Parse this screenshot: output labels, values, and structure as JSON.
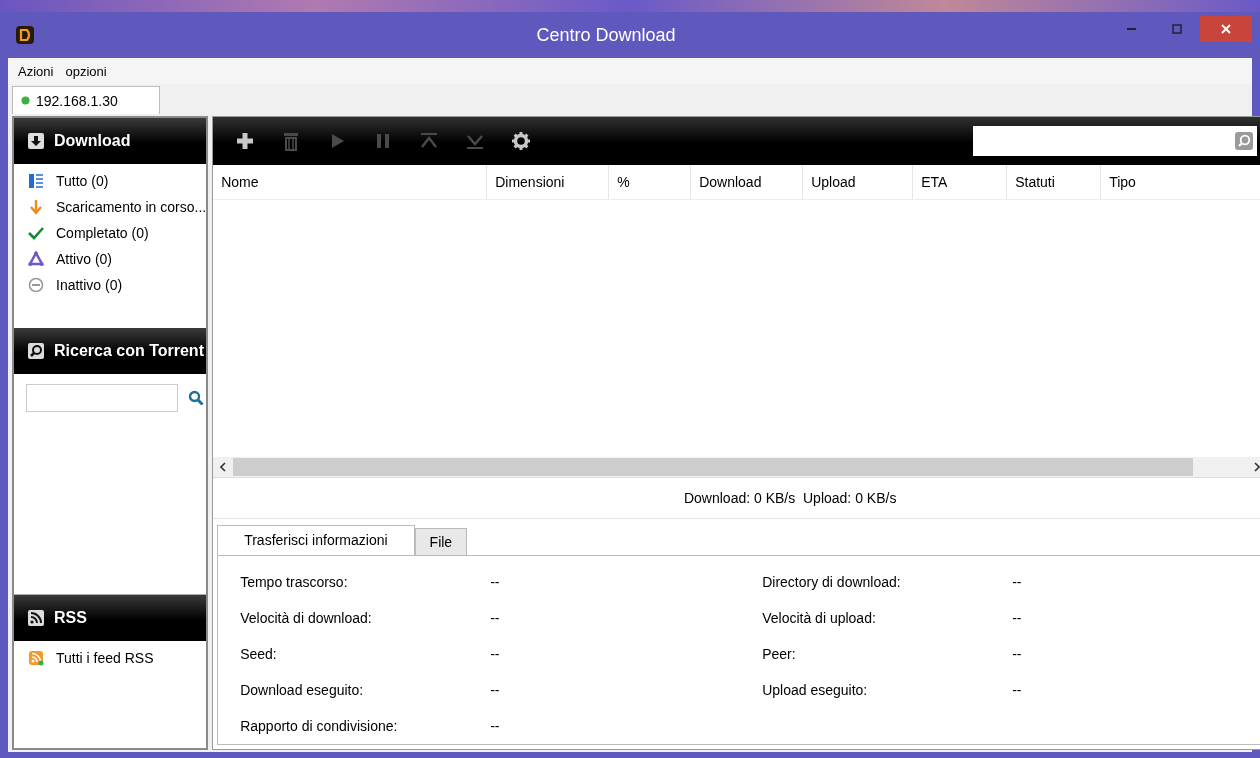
{
  "window": {
    "title": "Centro Download"
  },
  "menu": [
    "Azioni",
    "opzioni"
  ],
  "connection_tabs": [
    {
      "label": "192.168.1.30",
      "selected": true
    }
  ],
  "sidebar": [
    {
      "kind": "download",
      "title": "Download",
      "items": [
        {
          "kind": "all",
          "label": "Tutto (0)"
        },
        {
          "kind": "downloading",
          "label": "Scaricamento in corso..."
        },
        {
          "kind": "completed",
          "label": "Completato (0)"
        },
        {
          "kind": "active",
          "label": "Attivo (0)"
        },
        {
          "kind": "inactive",
          "label": "Inattivo (0)"
        }
      ]
    },
    {
      "kind": "search",
      "title": "Ricerca con Torrent"
    },
    {
      "kind": "rss",
      "title": "RSS",
      "items": [
        {
          "kind": "feed",
          "label": "Tutti i feed RSS"
        }
      ]
    }
  ],
  "toolbar": [
    {
      "kind": "add",
      "disabled": false
    },
    {
      "kind": "delete",
      "disabled": true
    },
    {
      "kind": "start",
      "disabled": true
    },
    {
      "kind": "pause",
      "disabled": true
    },
    {
      "kind": "top",
      "disabled": true
    },
    {
      "kind": "bottom",
      "disabled": true
    },
    {
      "kind": "settings",
      "disabled": false
    }
  ],
  "table": {
    "columns": [
      "Nome",
      "Dimensioni",
      "%",
      "Download",
      "Upload",
      "ETA",
      "Statuti",
      "Tipo"
    ]
  },
  "speed_status": "Download: 0 KB/s  Upload: 0 KB/s",
  "details": {
    "tabs": [
      {
        "label": "Trasferisci informazioni",
        "selected": true
      },
      {
        "label": "File",
        "selected": false
      }
    ],
    "left": [
      {
        "label": "Tempo trascorso:",
        "value": "--"
      },
      {
        "label": "Velocità di download:",
        "value": "--"
      },
      {
        "label": "Seed:",
        "value": "--"
      },
      {
        "label": "Download eseguito:",
        "value": "--"
      },
      {
        "label": "Rapporto di condivisione:",
        "value": "--"
      }
    ],
    "right": [
      {
        "label": "Directory di download:",
        "value": "--"
      },
      {
        "label": "Velocità di upload:",
        "value": "--"
      },
      {
        "label": "Peer:",
        "value": "--"
      },
      {
        "label": "Upload eseguito:",
        "value": "--"
      }
    ]
  }
}
